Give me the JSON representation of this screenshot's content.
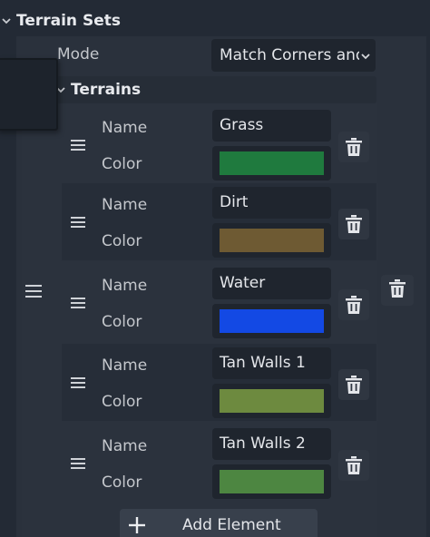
{
  "section": {
    "title": "Terrain Sets"
  },
  "mode": {
    "label": "Mode",
    "value": "Match Corners and Sides"
  },
  "terrains": {
    "title": "Terrains",
    "name_label": "Name",
    "color_label": "Color",
    "items": [
      {
        "name": "Grass",
        "color": "#1f7a3e"
      },
      {
        "name": "Dirt",
        "color": "#6e5a33"
      },
      {
        "name": "Water",
        "color": "#1349e4"
      },
      {
        "name": "Tan Walls 1",
        "color": "#6d8a3f"
      },
      {
        "name": "Tan Walls 2",
        "color": "#4d8641"
      }
    ]
  },
  "add_button": {
    "label": "Add Element"
  },
  "icons": {
    "collapse": "chevron-down-icon",
    "drag": "drag-handle-icon",
    "delete": "trash-icon",
    "add": "plus-icon"
  },
  "colors": {
    "background": "#232a35",
    "panel": "#2a313c",
    "field": "#1f252e",
    "text": "#e4e6ea"
  }
}
